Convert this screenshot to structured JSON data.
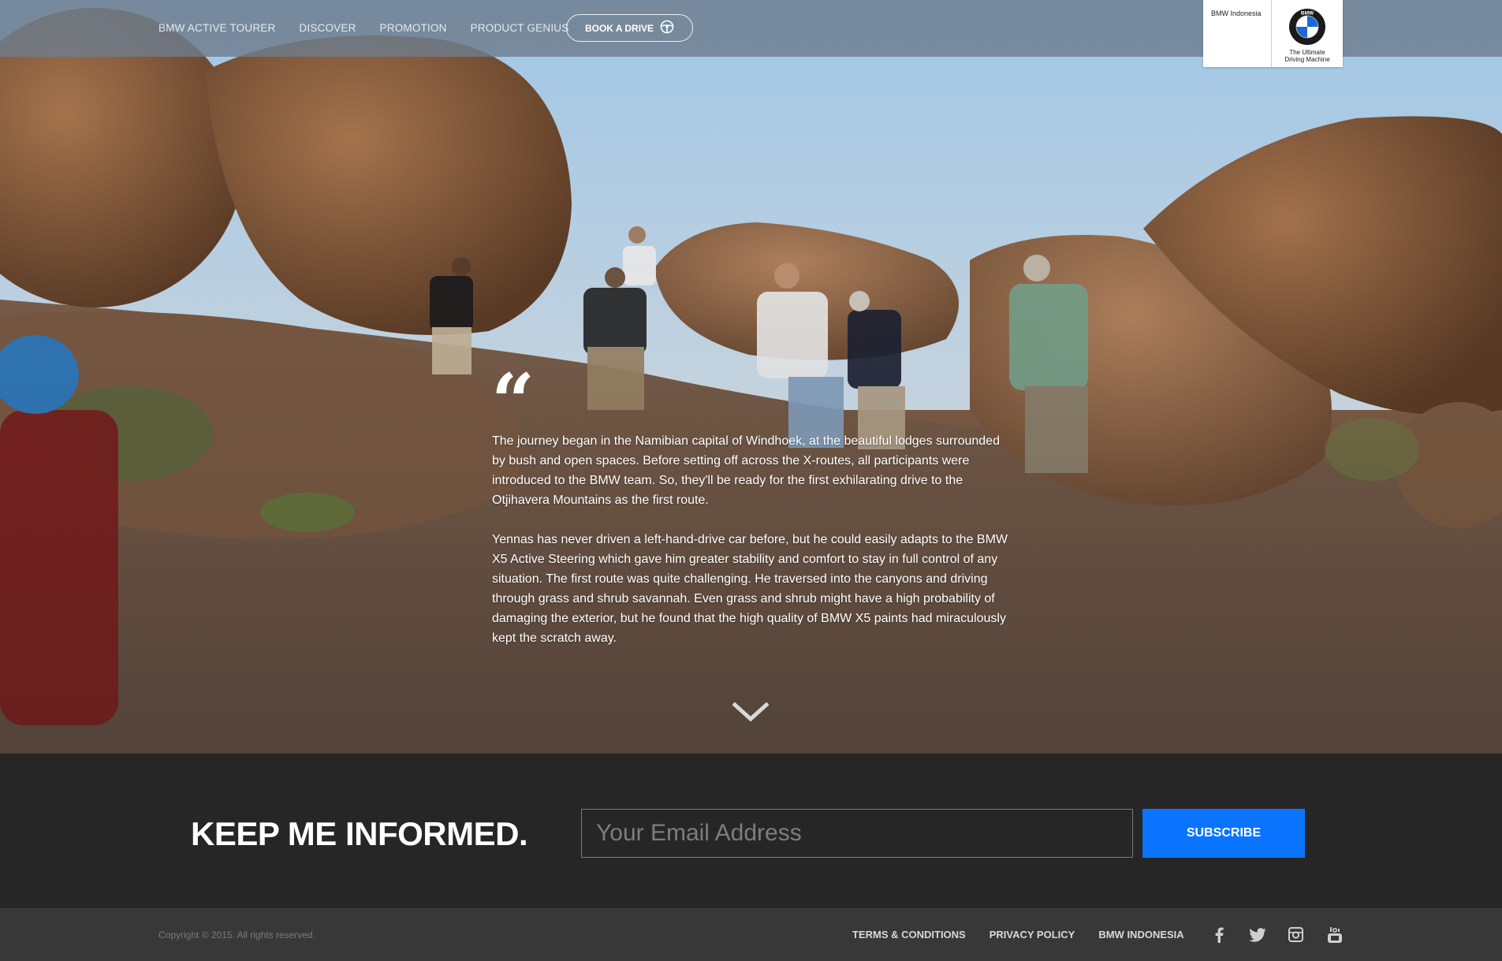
{
  "nav": {
    "links": [
      "BMW ACTIVE TOURER",
      "DISCOVER",
      "PROMOTION",
      "PRODUCT GENIUS"
    ],
    "book_label": "BOOK A DRIVE",
    "book_icon": "steering-wheel-icon"
  },
  "brand": {
    "name": "BMW Indonesia",
    "logo": "bmw-roundel-logo",
    "logo_letters": "BMW",
    "tagline_line1": "The Ultimate",
    "tagline_line2": "Driving Machine"
  },
  "hero": {
    "quote_mark": "“",
    "paragraphs": [
      "The journey began in the Namibian capital of Windhoek, at the beautiful lodges surrounded by bush and open spaces. Before setting off across the X-routes, all participants were introduced to the BMW team. So, they'll be ready for the first exhilarating drive to the Otjihavera Mountains as the first route.",
      "Yennas has never driven a left-hand-drive car before, but he could easily adapts to the BMW X5 Active Steering which gave him greater stability and comfort to stay in full control of any situation. The first route was quite challenging. He traversed into the canyons and driving through grass and shrub savannah. Even grass and shrub might have a high probability of damaging the exterior, but he found that the high quality of BMW X5 paints had miraculously kept the scratch away."
    ],
    "scroll_icon": "chevron-down-icon"
  },
  "subscribe": {
    "title": "KEEP ME INFORMED.",
    "email_placeholder": "Your Email Address",
    "email_value": "",
    "button_label": "SUBSCRIBE",
    "button_color": "#0a74ff"
  },
  "footer": {
    "copyright": "Copyright © 2015. All rights reserved.",
    "links": [
      "TERMS & CONDITIONS",
      "PRIVACY POLICY",
      "BMW INDONESIA"
    ],
    "socials": [
      "facebook-icon",
      "twitter-icon",
      "instagram-icon",
      "youtube-icon"
    ]
  }
}
